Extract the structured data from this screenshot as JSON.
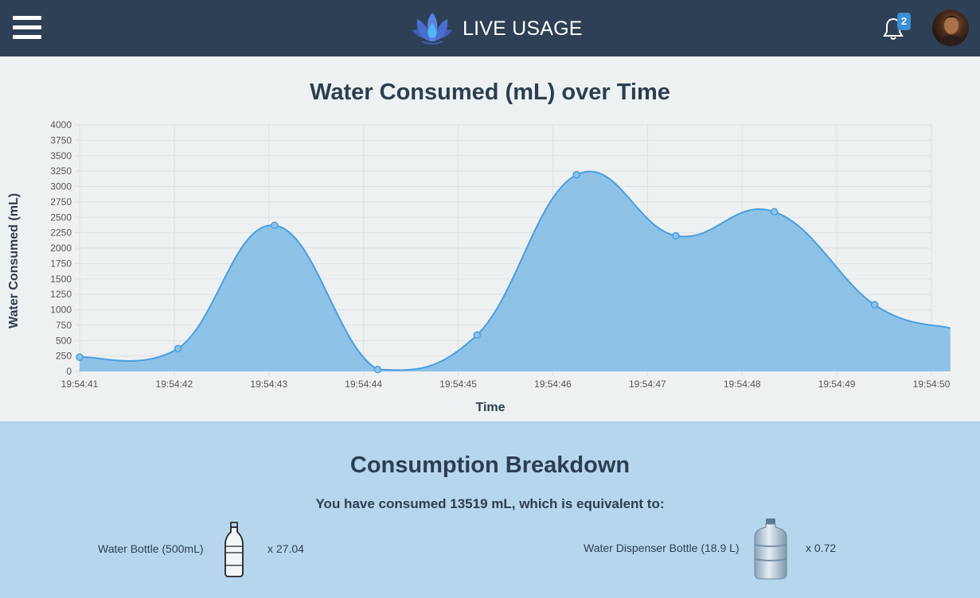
{
  "header": {
    "title": "LIVE USAGE",
    "notification_count": "2",
    "menu_icon": "hamburger-icon",
    "logo_icon": "lotus-water-drop-logo",
    "bell_icon": "bell-icon",
    "accent_color": "#2d4055"
  },
  "chart_data": {
    "type": "area",
    "title": "Water Consumed (mL) over Time",
    "xlabel": "Time",
    "ylabel": "Water Consumed (mL)",
    "ylim": [
      0,
      4000
    ],
    "yticks": [
      "0",
      "250",
      "500",
      "750",
      "1000",
      "1250",
      "1500",
      "1750",
      "2000",
      "2250",
      "2500",
      "2750",
      "3000",
      "3250",
      "3500",
      "3750",
      "4000"
    ],
    "xticks": [
      "19:54:41",
      "19:54:42",
      "19:54:43",
      "19:54:44",
      "19:54:45",
      "19:54:46",
      "19:54:47",
      "19:54:48",
      "19:54:49",
      "19:54:50"
    ],
    "grid": true,
    "fill_color": "#88bfe6",
    "line_color": "#4a9ee0",
    "series": [
      {
        "x": [
          41.0,
          42.04,
          43.06,
          44.15,
          45.2,
          46.25,
          47.3,
          48.34,
          49.4,
          50.2
        ],
        "values": [
          230,
          370,
          2370,
          30,
          590,
          3190,
          2200,
          2590,
          1080,
          700
        ]
      }
    ]
  },
  "breakdown": {
    "title": "Consumption Breakdown",
    "summary": "You have consumed 13519 mL, which is equivalent to:",
    "items": [
      {
        "label": "Water Bottle (500mL)",
        "multiplier": "x 27.04",
        "icon": "water-bottle-icon"
      },
      {
        "label": "Water Dispenser Bottle (18.9 L)",
        "multiplier": "x 0.72",
        "icon": "water-jug-icon"
      }
    ]
  }
}
